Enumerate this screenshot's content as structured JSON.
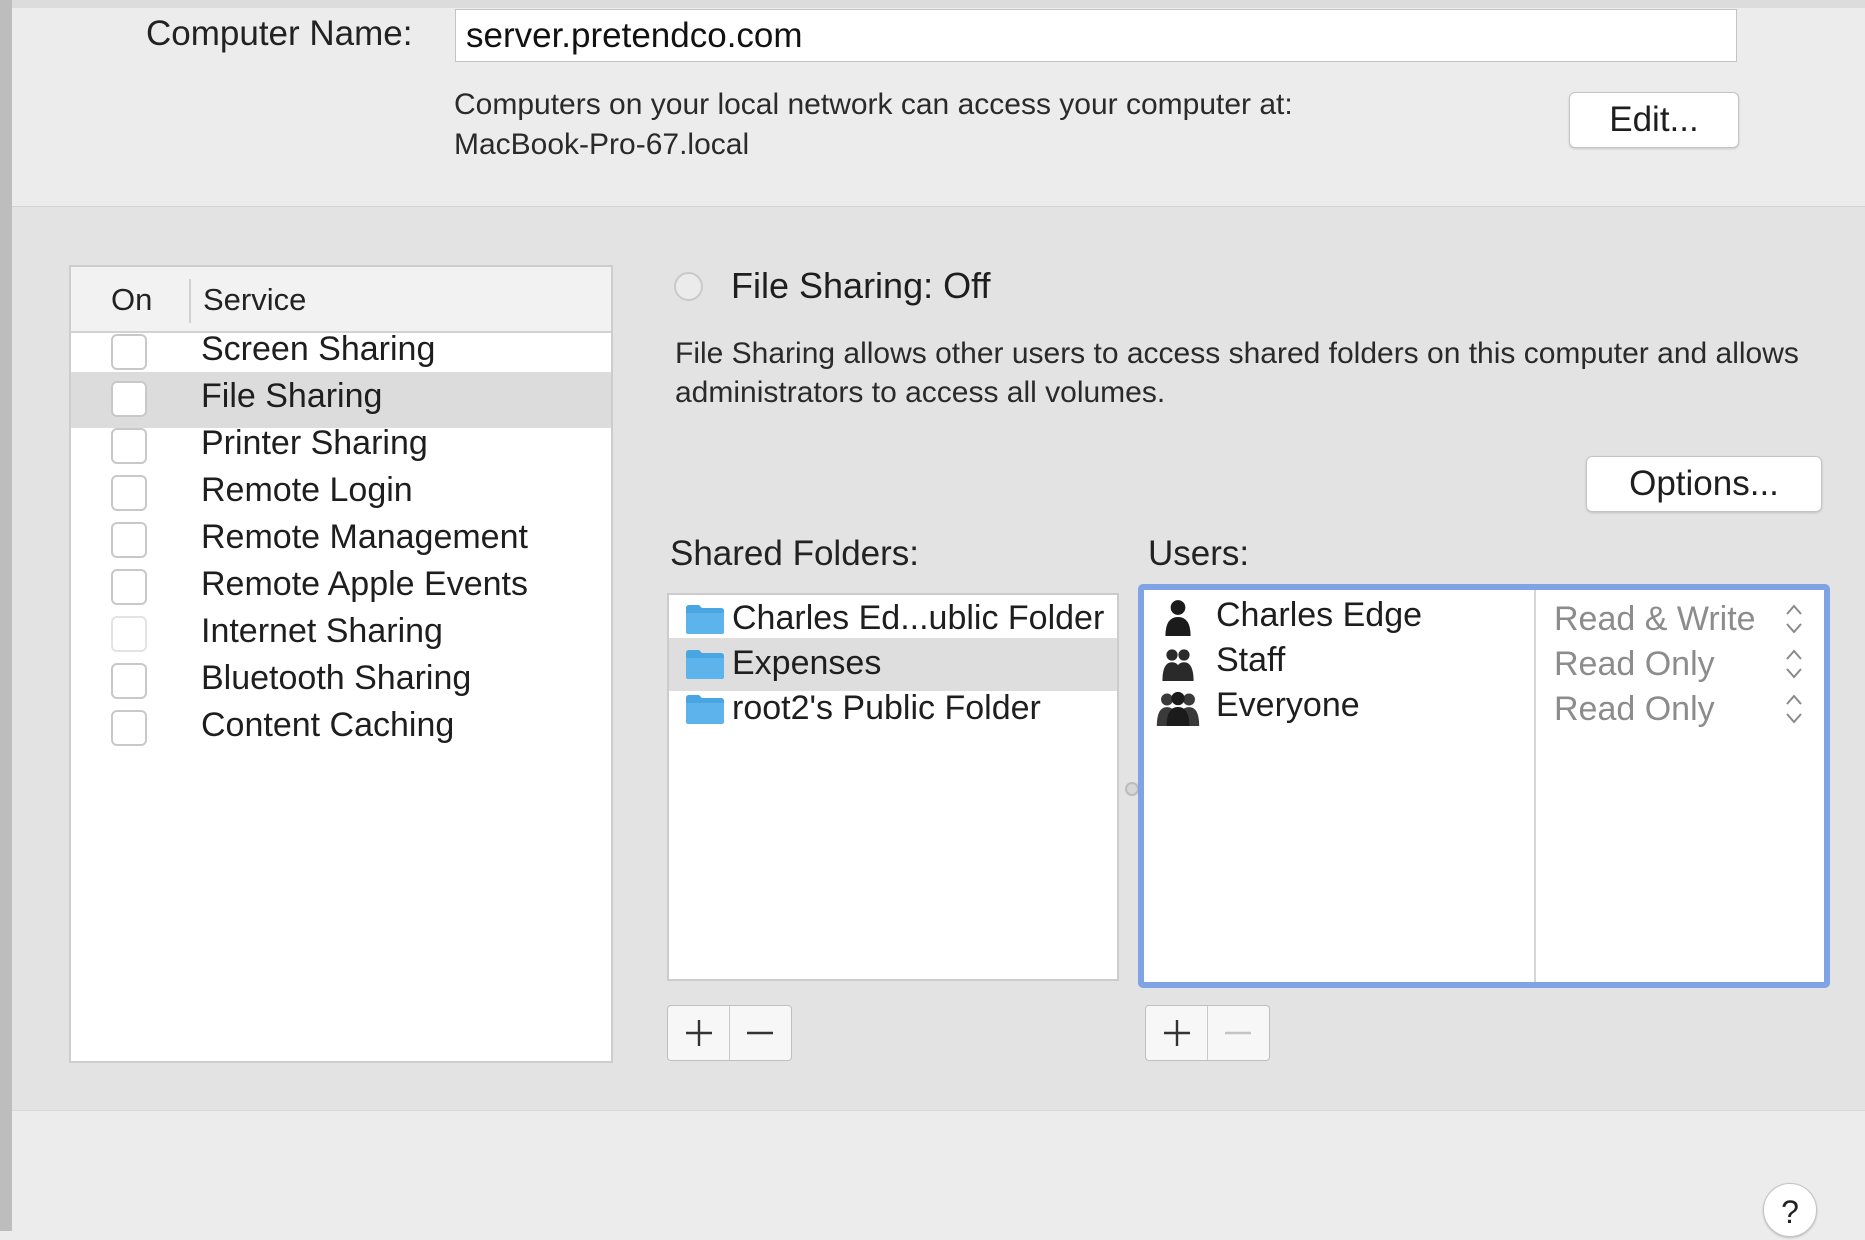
{
  "computer_name": {
    "label": "Computer Name:",
    "value": "server.pretendco.com",
    "local_info_line1": "Computers on your local network can access your computer at:",
    "local_info_line2": "MacBook-Pro-67.local",
    "edit_label": "Edit..."
  },
  "services": {
    "header_on": "On",
    "header_service": "Service",
    "items": [
      {
        "label": "Screen Sharing",
        "checked": false
      },
      {
        "label": "File Sharing",
        "checked": false,
        "selected": true
      },
      {
        "label": "Printer Sharing",
        "checked": false
      },
      {
        "label": "Remote Login",
        "checked": false
      },
      {
        "label": "Remote Management",
        "checked": false
      },
      {
        "label": "Remote Apple Events",
        "checked": false
      },
      {
        "label": "Internet Sharing",
        "checked": false,
        "disabled": true
      },
      {
        "label": "Bluetooth Sharing",
        "checked": false
      },
      {
        "label": "Content Caching",
        "checked": false
      }
    ]
  },
  "file_sharing": {
    "status": "File Sharing: Off",
    "description": "File Sharing allows other users to access shared folders on this computer and allows administrators to access all volumes.",
    "options_label": "Options..."
  },
  "shared_folders": {
    "label": "Shared Folders:",
    "items": [
      {
        "name": "Charles Ed...ublic Folder",
        "icon": "folder-icon"
      },
      {
        "name": "Expenses",
        "icon": "folder-icon",
        "selected": true
      },
      {
        "name": "root2's Public Folder",
        "icon": "folder-icon"
      }
    ]
  },
  "users": {
    "label": "Users:",
    "items": [
      {
        "name": "Charles Edge",
        "icon": "single-user-icon",
        "permission": "Read & Write"
      },
      {
        "name": "Staff",
        "icon": "group-icon",
        "permission": "Read Only"
      },
      {
        "name": "Everyone",
        "icon": "everyone-icon",
        "permission": "Read Only"
      }
    ]
  },
  "controls": {
    "add_symbol": "+",
    "remove_symbol": "−",
    "help_symbol": "?"
  },
  "colors": {
    "accent_focus": "#7ea4e6",
    "folder_blue": "#5db4ec",
    "selection_gray": "#dcdcdc"
  }
}
